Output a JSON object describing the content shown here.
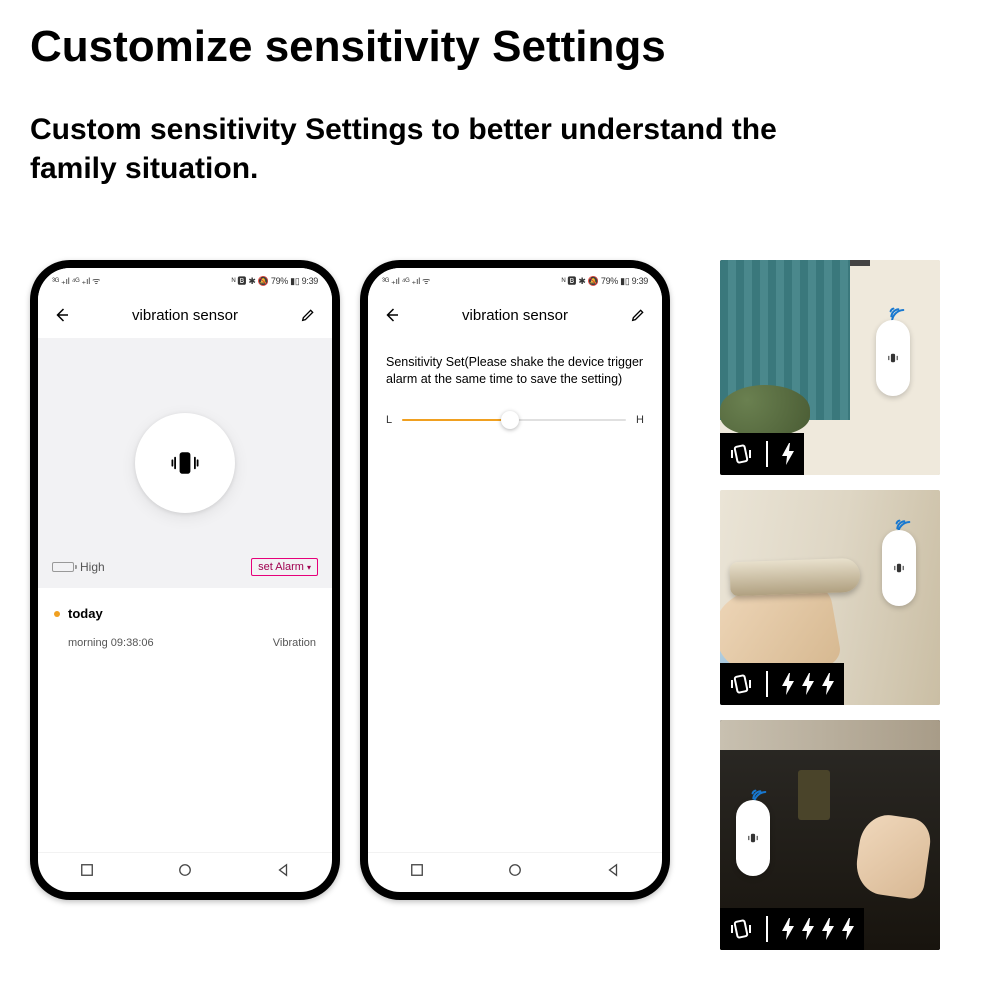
{
  "headline": "Customize sensitivity Settings",
  "subhead": "Custom sensitivity Settings to better understand the family situation.",
  "status": {
    "left": "³ᴳ ₊ıl ⁴ᴳ ₊ıl ᯤ",
    "right": "ᴺ 🅱 ✱ 🔕 79% ▮▯ 9:39",
    "battery_pct": "79%",
    "time": "9:39"
  },
  "phone1": {
    "title": "vibration sensor",
    "battery_label": "High",
    "set_alarm": "set Alarm",
    "today_label": "today",
    "event_time_label": "morning  09:38:06",
    "event_type": "Vibration"
  },
  "phone2": {
    "title": "vibration sensor",
    "sensitivity_text": "Sensitivity Set(Please shake the device trigger alarm at the same time to save the setting)",
    "low_label": "L",
    "high_label": "H"
  },
  "tiles": {
    "scene1": "wall",
    "scene2": "door-handle",
    "scene3": "safe",
    "bolt_counts": [
      1,
      3,
      4
    ]
  }
}
